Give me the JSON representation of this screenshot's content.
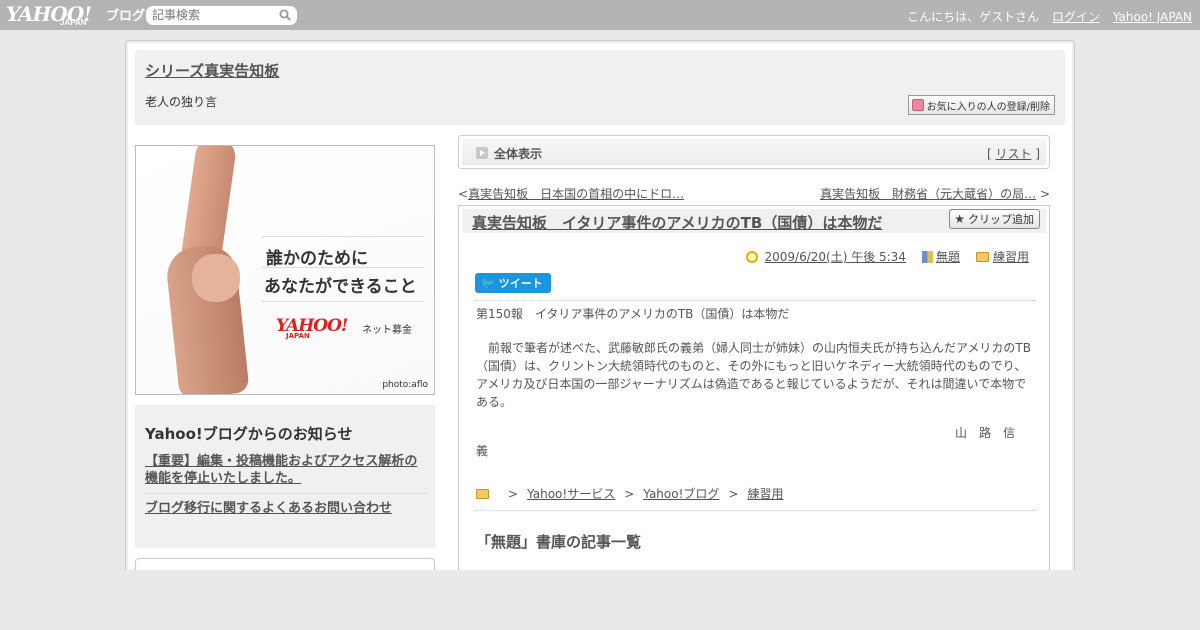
{
  "topbar": {
    "logo_text": "YAHOO!",
    "logo_sub": "JAPAN",
    "logo_service": "ブログ",
    "search_placeholder": "記事検索",
    "greeting": "こんにちは、ゲストさん",
    "login_label": "ログイン",
    "yahoo_japan_label": "Yahoo! JAPAN"
  },
  "header": {
    "blog_title": "シリーズ真実告知板",
    "blog_description": "老人の独り言",
    "favorite_button_label": "お気に入りの人の登録/削除"
  },
  "ad": {
    "line1": "誰かのために",
    "line2": "あなたができること",
    "brand": "YAHOO!",
    "brand_sub": "JAPAN",
    "service": "ネット募金",
    "credit": "photo:aflo"
  },
  "notice": {
    "title": "Yahoo!ブログからのお知らせ",
    "items": [
      "【重要】編集・投稿機能およびアクセス解析の機能を停止いたしました。",
      "ブログ移行に関するよくあるお問い合わせ"
    ]
  },
  "list_header": {
    "title": "全体表示",
    "list_bracket_open": "[",
    "list_link": "リスト",
    "list_bracket_close": "]"
  },
  "pager": {
    "prev_arrow": "<",
    "prev_label": "真実告知板　日本国の首相の中にドロ…",
    "next_label": "真実告知板　財務省（元大蔵省）の局…",
    "next_arrow": ">"
  },
  "article": {
    "title": "真実告知板　イタリア事件のアメリカのTB（国債）は本物だ",
    "clip_button_label": "クリップ追加",
    "date": "2009/6/20(土) 午後 5:34",
    "category": "無題",
    "folder": "練習用",
    "tweet_label": "ツイート",
    "paragraph1": "第150報　イタリア事件のアメリカのTB（国債）は本物だ",
    "paragraph2": "　前報で筆者が述べた、武藤敏郎氏の義弟（婦人同士が姉妹）の山内恒夫氏が持ち込んだアメリカのTB（国債）は、クリントン大統領時代のものと、その外にもっと旧いケネディー大統領時代のものでり、アメリカ及び日本国の一部ジャーナリズムは偽造であると報じているようだが、それは間違いで本物である。",
    "signature_line1": "山　路　信",
    "signature_line2": "義",
    "breadcrumbs": [
      "Yahoo!サービス",
      "Yahoo!ブログ",
      "練習用"
    ],
    "breadcrumb_separator": ">",
    "archive_title": "「無題」書庫の記事一覧"
  }
}
